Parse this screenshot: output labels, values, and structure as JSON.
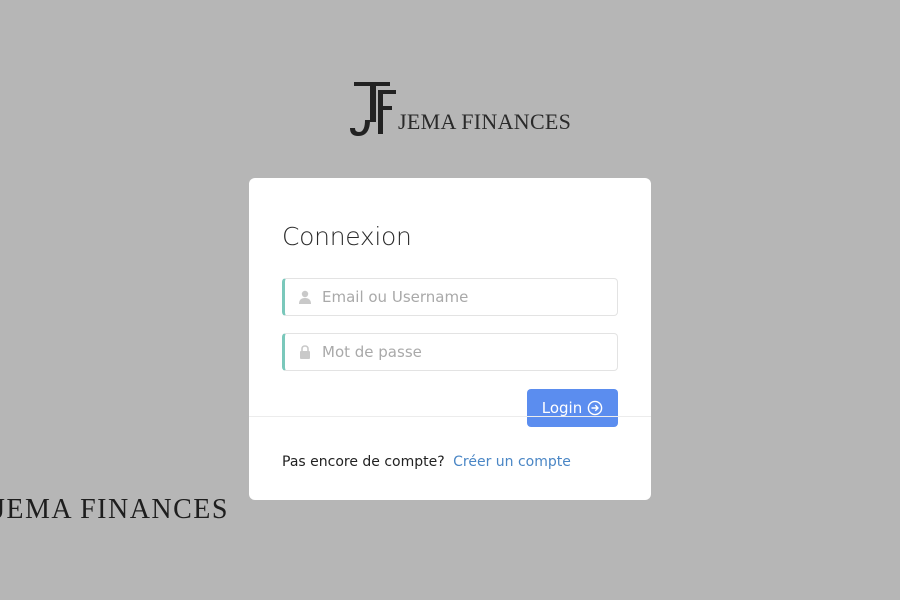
{
  "brand": {
    "logo_text": "JEMA FINANCES",
    "watermark_text": "JEMA FINANCES"
  },
  "login_card": {
    "title": "Connexion",
    "username_placeholder": "Email ou Username",
    "password_placeholder": "Mot de passe",
    "login_label": "Login",
    "no_account_text": "Pas encore de compte?",
    "create_account_link": "Créer un compte"
  },
  "icons": {
    "username": "user-icon",
    "password": "lock-icon",
    "login": "arrow-circle-right-icon"
  },
  "colors": {
    "background": "#b6b6b6",
    "primary_button": "#5b8def",
    "field_accent": "#7ac8bb",
    "link": "#4a86c5"
  }
}
